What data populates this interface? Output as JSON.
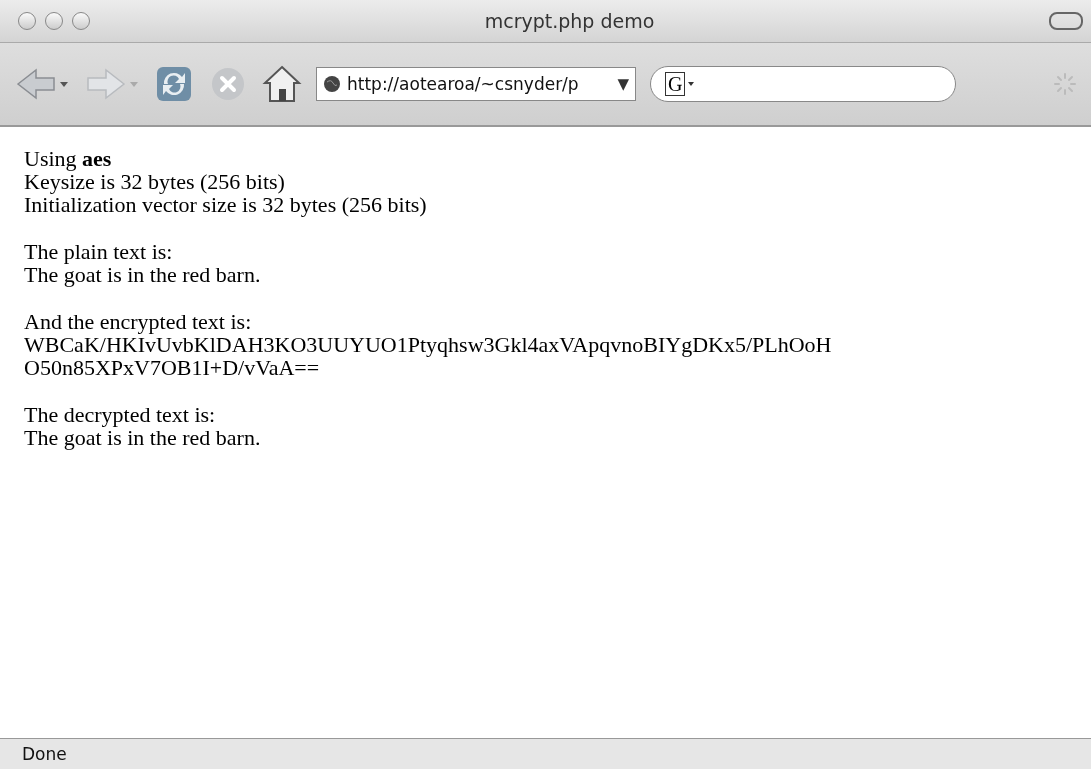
{
  "window": {
    "title": "mcrypt.php demo"
  },
  "toolbar": {
    "url": "http://aotearoa/~csnyder/p",
    "url_menu": "▼",
    "search_engine": "G"
  },
  "content": [
    [
      "Using **aes**",
      "Keysize is 32 bytes (256 bits)",
      "Initialization vector size is 32 bytes (256 bits)"
    ],
    [
      "The plain text is:",
      "The goat is in the red barn."
    ],
    [
      "And the encrypted text is:",
      "WBCaK/HKIvUvbKlDAH3KO3UUYUO1Ptyqhsw3Gkl4axVApqvnoBIYgDKx5/PLhOoH",
      "O50n85XPxV7OB1I+D/vVaA=="
    ],
    [
      "The decrypted text is:",
      "The goat is in the red barn."
    ]
  ],
  "status_bar": "Done"
}
